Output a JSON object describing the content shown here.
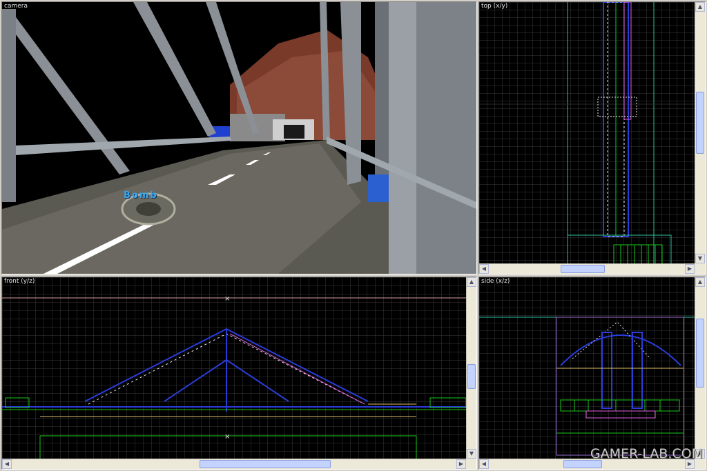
{
  "viewports": {
    "camera": {
      "title": "camera"
    },
    "top": {
      "title": "top (x/y)"
    },
    "front": {
      "title": "front (y/z)"
    },
    "side": {
      "title": "side (x/z)"
    }
  },
  "hud": {
    "item_label": "Bomb"
  },
  "watermark": "GAMER-LAB.COM",
  "colors": {
    "grid": "#3a3a3a",
    "brush_blue": "#2a3cd8",
    "brush_green": "#18c818",
    "brush_pink": "#e060e0",
    "brush_white": "#e8e8e8",
    "scroll_bg": "#ece9d8",
    "scroll_thumb": "#c3d3fd"
  },
  "icons": {
    "scroll_up": "arrow-up-icon",
    "scroll_down": "arrow-down-icon",
    "scroll_left": "arrow-left-icon",
    "scroll_right": "arrow-right-icon"
  }
}
